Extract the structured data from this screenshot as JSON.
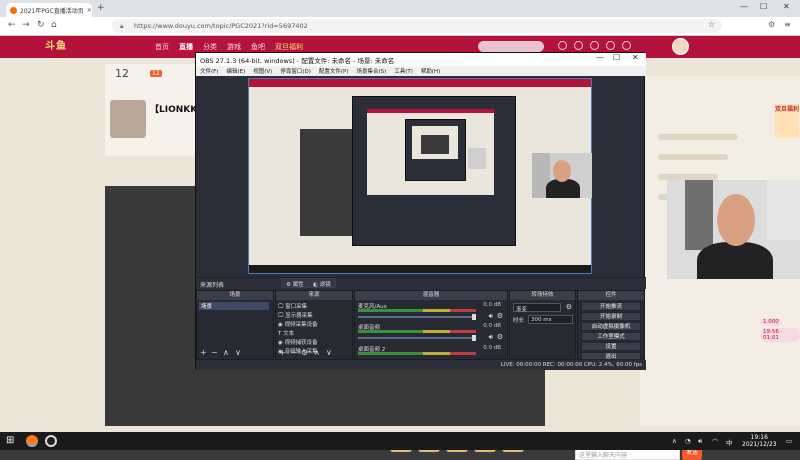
{
  "browser": {
    "tab_title": "2021年PGC直播活动页",
    "new_tab_icon": "plus-icon",
    "url": "https://www.douyu.com/topic/PGC2021?rid=5697402"
  },
  "site": {
    "nav": [
      "首页",
      "直播",
      "分类",
      "游戏",
      "鱼吧",
      "双旦福利"
    ],
    "active_nav": "直播",
    "logo": "斗鱼",
    "fan_count": "12",
    "fan_badge": "12",
    "streamer_name": "【LIONKK】",
    "lottery_badge": "双旦福利",
    "level_pills": [
      "1.000",
      "19:56 · 01:01"
    ],
    "chat_placeholder": "这里输入聊天内容",
    "send_label": "发送",
    "brand_color": "#b3123a"
  },
  "obs": {
    "title": "OBS 27.1.3 (64-bit, windows) - 配置文件: 未命名 - 场景: 未命名",
    "menu": [
      "文件(F)",
      "编辑(E)",
      "视图(V)",
      "停靠窗口(D)",
      "配置文件(P)",
      "场景集合(S)",
      "工具(T)",
      "帮助(H)"
    ],
    "control_label": "来源列表",
    "tabs": [
      "属性",
      "滤镜"
    ],
    "docks": {
      "scenes": {
        "header": "场景",
        "items": [
          "场景"
        ]
      },
      "sources": {
        "header": "来源",
        "items": [
          "窗口采集",
          "显示器采集",
          "视频采集设备",
          "文本",
          "视频捕获设备",
          "音频输入采集"
        ]
      },
      "mixer": {
        "header": "混音器",
        "channels": [
          {
            "name": "麦克风/Aux",
            "db": "0.0 dB"
          },
          {
            "name": "桌面音频",
            "db": "0.0 dB"
          },
          {
            "name": "桌面音频 2",
            "db": "0.0 dB"
          }
        ]
      },
      "transitions": {
        "header": "转场特效",
        "select": "渐变",
        "duration_label": "时长",
        "duration": "300 ms"
      },
      "controls": {
        "header": "控件",
        "buttons": [
          "开始推流",
          "开始录制",
          "启动虚拟摄像机",
          "工作室模式",
          "设置",
          "退出"
        ]
      }
    },
    "status": "LIVE: 00:00:00   REC: 00:00:00   CPU: 2.4%, 60.00 fps"
  },
  "taskbar": {
    "time": "19:16",
    "date": "2021/12/23"
  }
}
